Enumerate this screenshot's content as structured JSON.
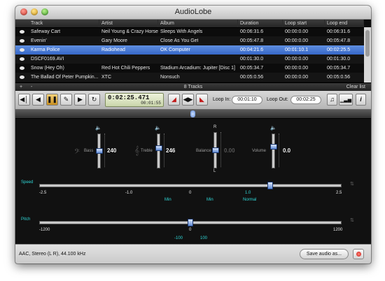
{
  "window": {
    "title": "AudioLobe"
  },
  "table": {
    "columns": [
      "Track",
      "Artist",
      "Album",
      "Duration",
      "Loop start",
      "Loop end"
    ],
    "rows": [
      {
        "track": "Safeway Cart",
        "artist": "Neil Young & Crazy Horse",
        "album": "Sleeps With Angels",
        "duration": "00:06:31.6",
        "loop_start": "00:00:0.00",
        "loop_end": "00:06:31.6",
        "selected": false
      },
      {
        "track": "Evenin'",
        "artist": "Gary Moore",
        "album": "Close As You Get",
        "duration": "00:05:47.8",
        "loop_start": "00:00:0.00",
        "loop_end": "00:05:47.8",
        "selected": false
      },
      {
        "track": "Karma Police",
        "artist": "Radiohead",
        "album": "OK Computer",
        "duration": "00:04:21.6",
        "loop_start": "00:01:10.1",
        "loop_end": "00:02:25.5",
        "selected": true
      },
      {
        "track": "DSCF0169.AVI",
        "artist": "",
        "album": "",
        "duration": "00:01:30.0",
        "loop_start": "00:00:0.00",
        "loop_end": "00:01:30.0",
        "selected": false
      },
      {
        "track": "Snow (Hey Oh)",
        "artist": "Red Hot Chili Peppers",
        "album": "Stadium Arcadium: Jupiter [Disc 1]",
        "duration": "00:05:34.7",
        "loop_start": "00:00:0.00",
        "loop_end": "00:05:34.7",
        "selected": false
      },
      {
        "track": "The Ballad Of Peter Pumpkin...",
        "artist": "XTC",
        "album": "Nonsuch",
        "duration": "00:05:0.56",
        "loop_start": "00:00:0.00",
        "loop_end": "00:05:0.56",
        "selected": false
      }
    ]
  },
  "list_footer": {
    "add": "+",
    "remove": "-",
    "count": "8 Tracks",
    "clear": "Clear list"
  },
  "transport": {
    "time_main": "0:02:25.471",
    "time_small": "00:01:55",
    "loop_in_label": "Loop In:",
    "loop_in_value": "00:01:10",
    "loop_out_label": "Loop Out:",
    "loop_out_value": "00:02:25"
  },
  "seek_position": 0.5,
  "mixer": {
    "bass": {
      "label": "Bass",
      "value": "240",
      "level": 0.5
    },
    "treble": {
      "label": "Treble",
      "value": "246",
      "level": 0.6
    },
    "balance": {
      "label": "Balance",
      "value": "0.00",
      "level": 0.5,
      "top": "R",
      "bottom": "L"
    },
    "volume": {
      "label": "Volume",
      "value": "0.0",
      "level": 0.65
    }
  },
  "speed": {
    "label": "Speed",
    "ticks": [
      "-2.5",
      "-1.0",
      "0",
      "1.0",
      "2.5"
    ],
    "sub_labels": [
      "Min",
      "Min",
      "Normal"
    ],
    "position": 0.77
  },
  "pitch": {
    "label": "Pitch",
    "ticks": [
      "-1200",
      "0",
      "1200"
    ],
    "sub_labels": [
      "-100",
      "100"
    ],
    "position": 0.5
  },
  "status": {
    "format": "AAC, Stereo (L R), 44.100 kHz",
    "save_button": "Save audio as..."
  },
  "colors": {
    "selection": "#3d6ecf",
    "accent": "#2fd8d8",
    "record": "#c90f0f"
  }
}
